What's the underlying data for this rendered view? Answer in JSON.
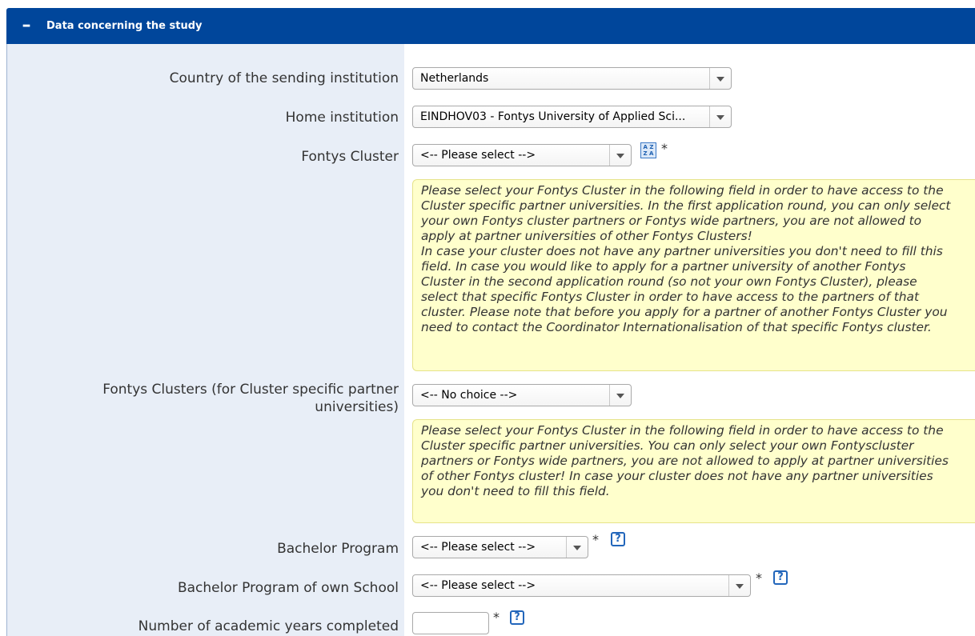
{
  "section": {
    "toggle_label": "–",
    "title": "Data concerning the study"
  },
  "fields": {
    "country": {
      "label": "Country of the sending institution",
      "value": "Netherlands"
    },
    "home_institution": {
      "label": "Home institution",
      "value": "EINDHOV03 - Fontys University of Applied Sci..."
    },
    "fontys_cluster": {
      "label": "Fontys Cluster",
      "value": "<-- Please select -->",
      "required": "*"
    },
    "cluster_info": "Please select your Fontys Cluster in the following field in order to have access to the\nCluster specific partner universities. In the first application round, you can only select\nyour own Fontys cluster partners or Fontys wide partners, you are not allowed to\napply at partner universities of other Fontys Clusters!\nIn case your cluster does not have any partner universities you don't need to fill this\nfield. In case you would like to apply for a partner university of another Fontys\nCluster in the second application round (so not your own Fontys Cluster), please\nselect that specific Fontys Cluster in order to have access to the partners of that\ncluster. Please note that before you apply for a partner of another Fontys Cluster you\nneed to contact the Coordinator Internationalisation of that specific Fontys cluster.",
    "fontys_clusters_partner": {
      "label_line1": "Fontys Clusters (for Cluster specific partner",
      "label_line2": "universities)",
      "value": "<-- No choice -->"
    },
    "clusters_partner_info": "Please select your Fontys Cluster in the following field in order to have access to the\nCluster specific partner universities. You can only select your own Fontyscluster\npartners or Fontys wide partners, you are not allowed to apply at partner universities\nof other Fontys cluster! In case your cluster does not have any partner universities\nyou don't need to fill this field.",
    "bachelor_program": {
      "label": "Bachelor Program",
      "value": "<-- Please select -->",
      "required": "*",
      "help": "?"
    },
    "bachelor_program_own_school": {
      "label": "Bachelor Program of own School",
      "value": "<-- Please select -->",
      "required": "*",
      "help": "?"
    },
    "academic_years": {
      "label": "Number of academic years completed",
      "value": "",
      "required": "*",
      "help": "?"
    }
  },
  "colors": {
    "header_bg": "#00469b",
    "label_col_bg": "#e8eef7",
    "info_bg": "#ffffcc",
    "help_icon": "#2266bb"
  }
}
